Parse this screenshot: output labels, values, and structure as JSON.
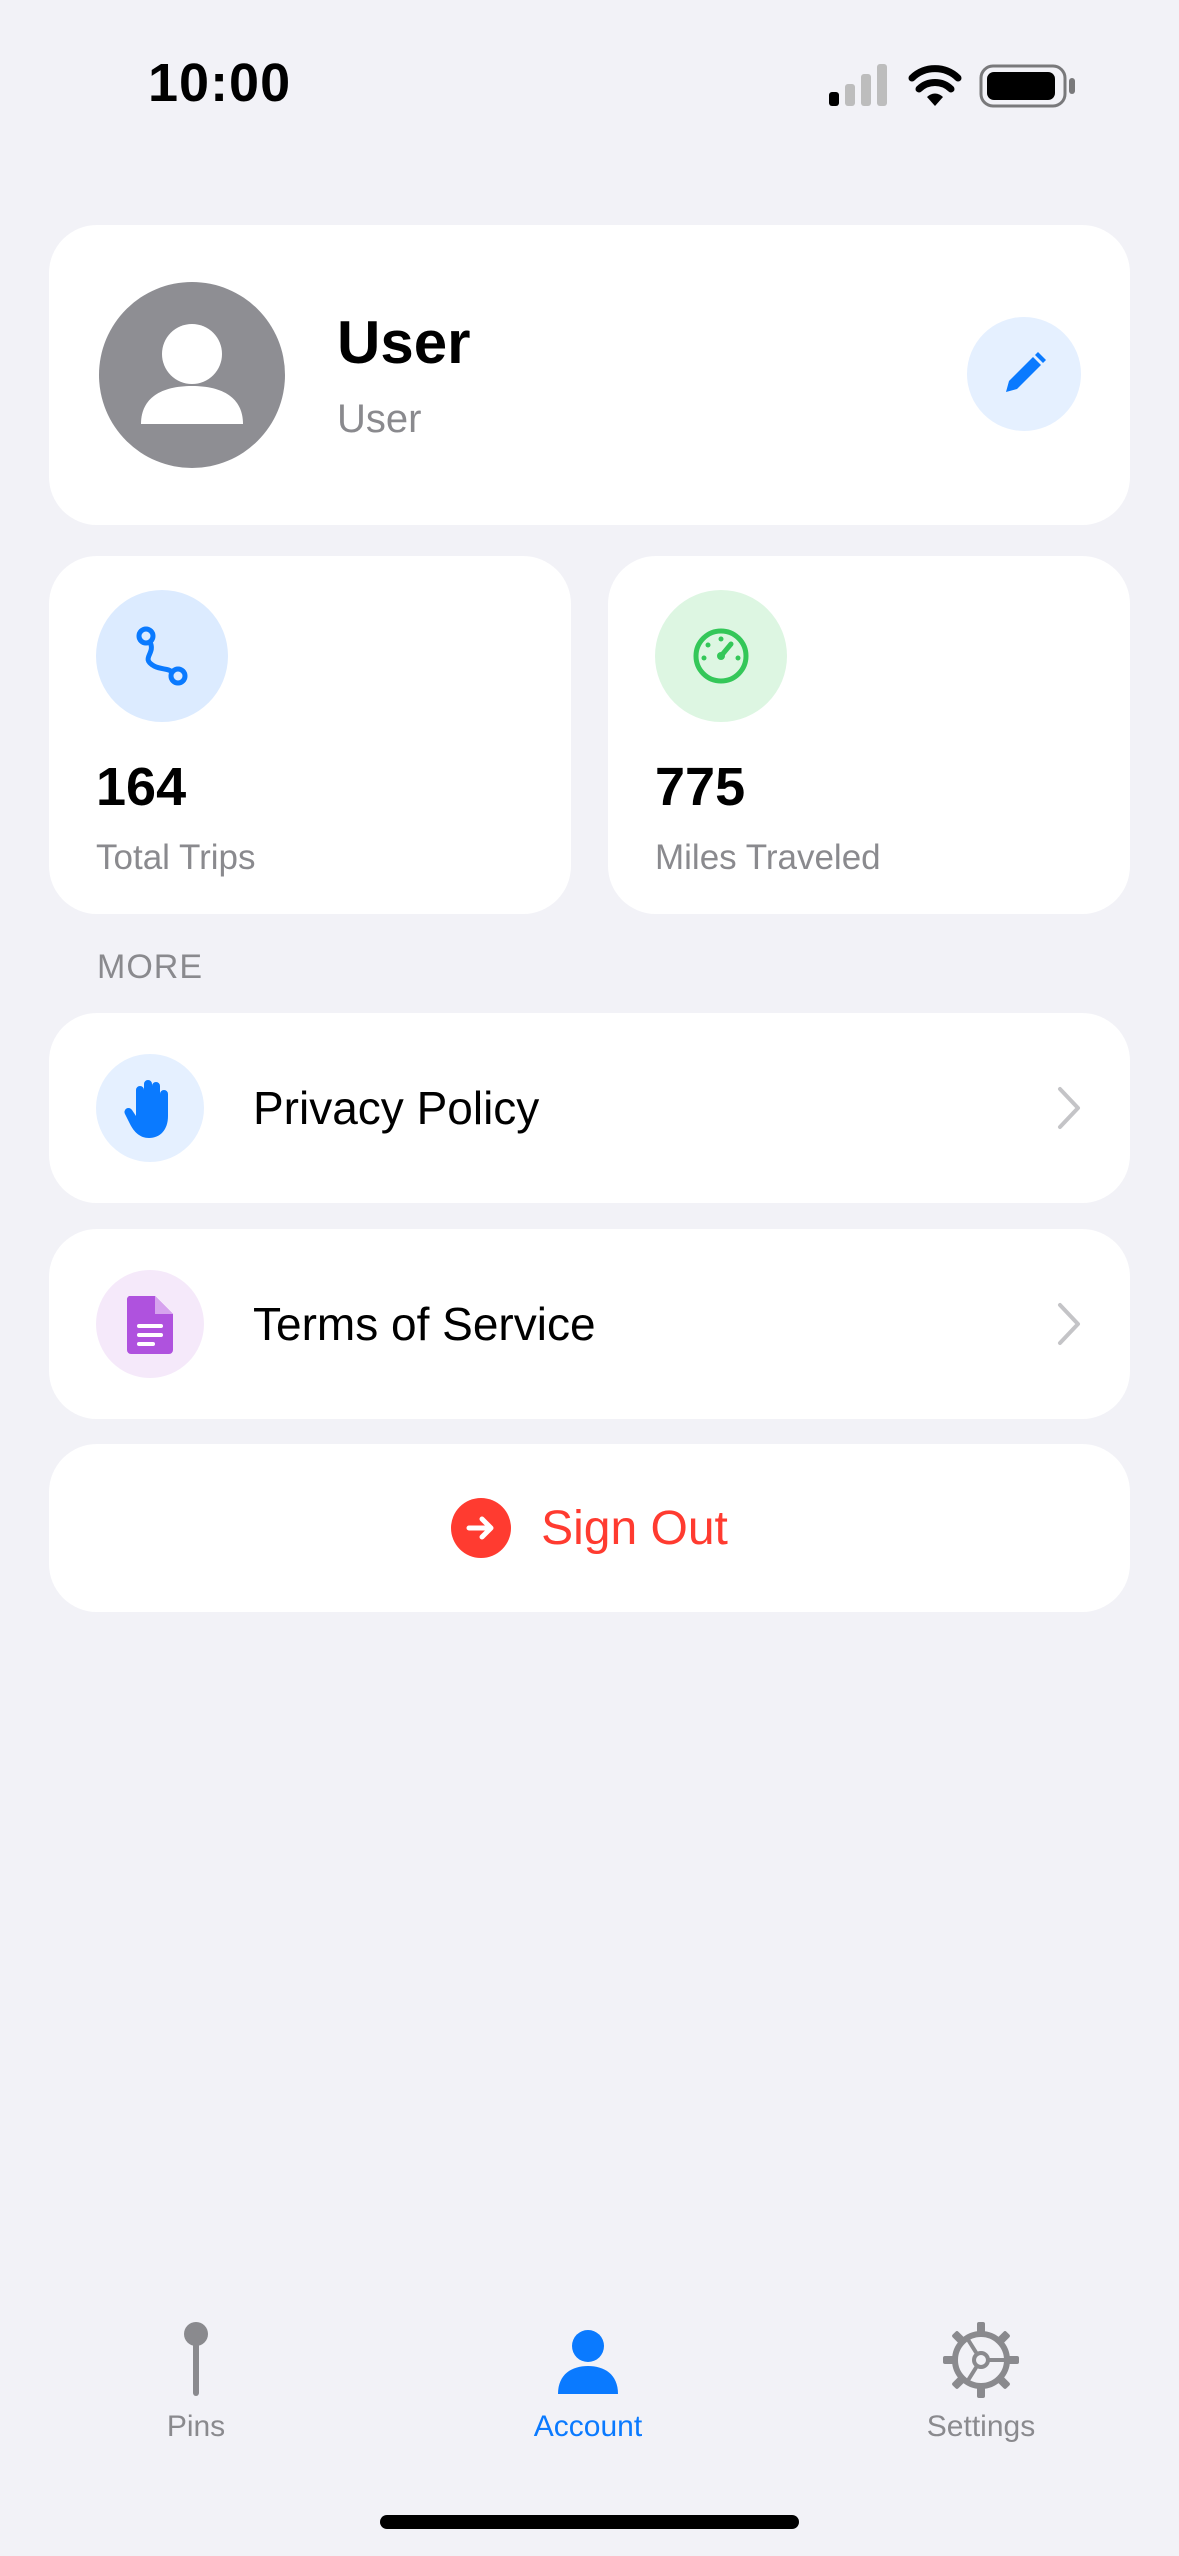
{
  "status_bar": {
    "time": "10:00",
    "icons": [
      "cellular-signal-icon",
      "wifi-icon",
      "battery-icon"
    ]
  },
  "profile": {
    "name": "User",
    "subtitle": "User",
    "avatar_icon": "person-icon",
    "edit_icon": "pencil-icon"
  },
  "stats": [
    {
      "value": "164",
      "label": "Total Trips",
      "icon": "route-icon",
      "icon_bg": "#DCEBFF",
      "icon_color": "#0A7AFF"
    },
    {
      "value": "775",
      "label": "Miles Traveled",
      "icon": "speedometer-icon",
      "icon_bg": "#DDF6E2",
      "icon_color": "#34C759"
    }
  ],
  "more": {
    "header": "MORE",
    "items": [
      {
        "label": "Privacy Policy",
        "icon": "hand-raised-icon",
        "icon_bg": "#E5F0FF",
        "icon_color": "#0A7AFF"
      },
      {
        "label": "Terms of Service",
        "icon": "document-icon",
        "icon_bg": "#F5E9FA",
        "icon_color": "#AF52DE"
      }
    ]
  },
  "sign_out": {
    "label": "Sign Out",
    "color": "#FF3B30",
    "icon": "arrow-right-circle-icon"
  },
  "tab_bar": {
    "active_color": "#0A7AFF",
    "inactive_color": "#8A8A8E",
    "tabs": [
      {
        "label": "Pins",
        "icon": "pin-icon",
        "active": false
      },
      {
        "label": "Account",
        "icon": "person-icon",
        "active": true
      },
      {
        "label": "Settings",
        "icon": "gear-icon",
        "active": false
      }
    ]
  }
}
